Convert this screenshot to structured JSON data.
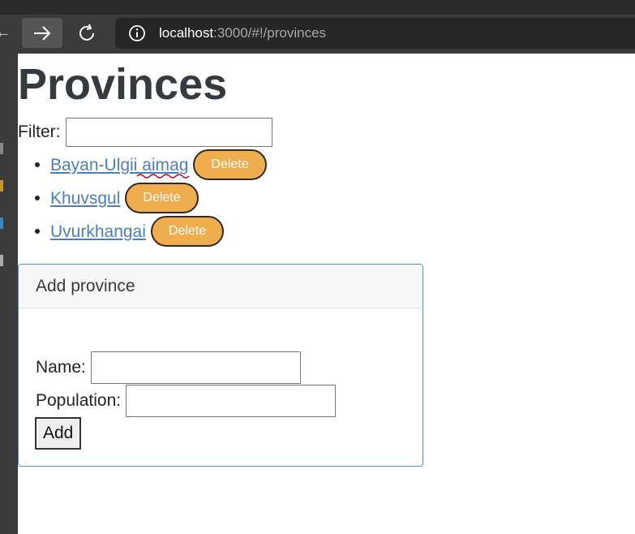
{
  "browser": {
    "url_host": "localhost",
    "url_path": ":3000/#!/provinces"
  },
  "page": {
    "title": "Provinces",
    "filter_label": "Filter:",
    "filter_value": "",
    "provinces": [
      {
        "name": "Bayan-Ulgii aimag",
        "delete_label": "Delete"
      },
      {
        "name": "Khuvsgul",
        "delete_label": "Delete"
      },
      {
        "name": "Uvurkhangai",
        "delete_label": "Delete"
      }
    ],
    "add_card": {
      "title": "Add province",
      "name_label": "Name:",
      "name_value": "",
      "population_label": "Population:",
      "population_value": "",
      "add_button": "Add"
    }
  },
  "colors": {
    "link": "#4a7fc1",
    "delete_button": "#f0ad4e",
    "card_border": "#4a90c8"
  }
}
